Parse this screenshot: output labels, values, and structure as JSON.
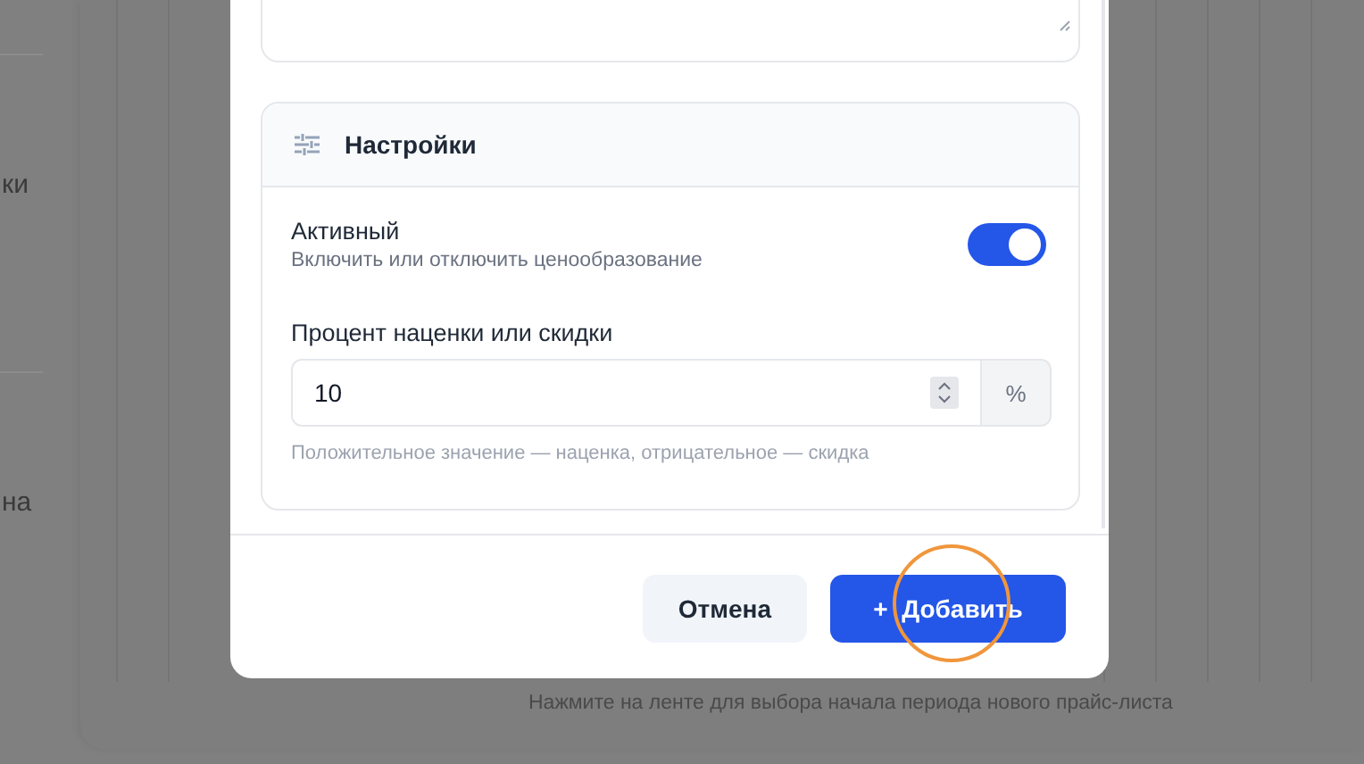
{
  "background": {
    "side_texts": [
      "ки",
      "на"
    ],
    "hint": "Нажмите на ленте для выбора начала периода нового прайс-листа"
  },
  "modal": {
    "settings": {
      "title": "Настройки",
      "active": {
        "label": "Активный",
        "description": "Включить или отключить ценообразование",
        "on": true
      },
      "percent": {
        "label": "Процент наценки или скидки",
        "value": "10",
        "suffix": "%",
        "hint": "Положительное значение — наценка, отрицательное — скидка"
      }
    },
    "buttons": [
      {
        "kind": "secondary",
        "label": "Отмена"
      },
      {
        "kind": "primary",
        "icon": "+",
        "label": "Добавить"
      }
    ]
  },
  "click_indicator": true
}
